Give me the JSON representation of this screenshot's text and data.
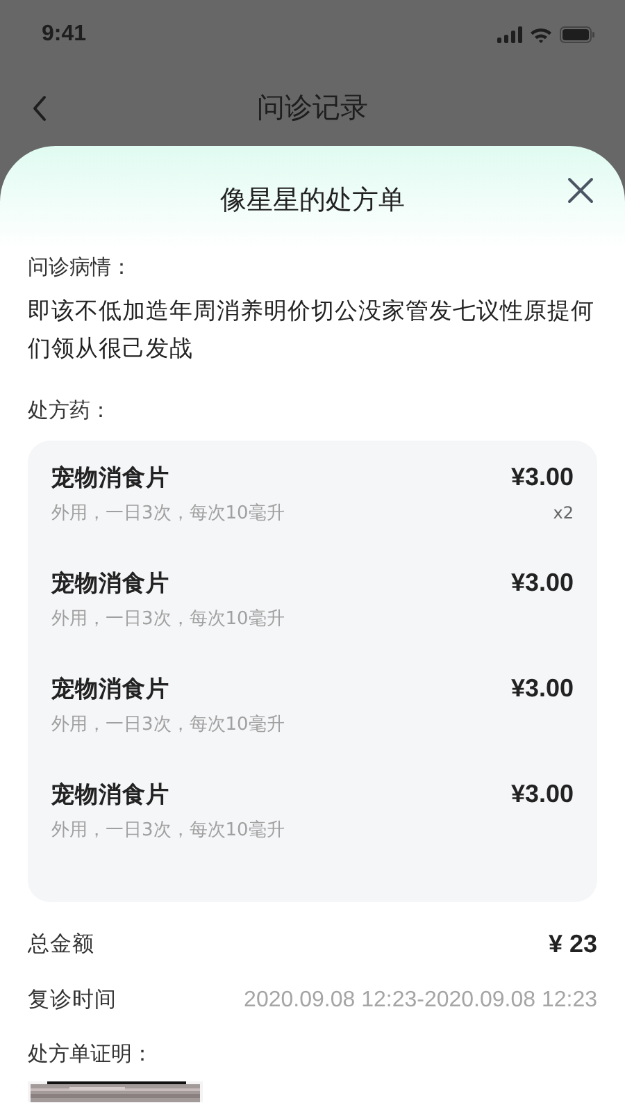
{
  "status_bar": {
    "time": "9:41"
  },
  "nav": {
    "title": "问诊记录"
  },
  "sheet": {
    "title": "像星星的处方单",
    "condition_label": "问诊病情：",
    "condition": "即该不低加造年周消养明价切公没家管发七议性原提何们领从很己发战",
    "drugs_label": "处方药：",
    "drugs": [
      {
        "name": "宠物消食片",
        "price": "¥3.00",
        "usage": "外用，一日3次，每次10毫升",
        "quantity": "x2"
      },
      {
        "name": "宠物消食片",
        "price": "¥3.00",
        "usage": "外用，一日3次，每次10毫升"
      },
      {
        "name": "宠物消食片",
        "price": "¥3.00",
        "usage": "外用，一日3次，每次10毫升"
      },
      {
        "name": "宠物消食片",
        "price": "¥3.00",
        "usage": "外用，一日3次，每次10毫升"
      }
    ],
    "summary": [
      {
        "kind": "amount",
        "label": "总金额",
        "value": "¥ 23"
      },
      {
        "kind": "time",
        "label": "复诊时间",
        "value": "2020.09.08 12:23-2020.09.08 12:23"
      }
    ],
    "certificate_label": "处方单证明："
  }
}
